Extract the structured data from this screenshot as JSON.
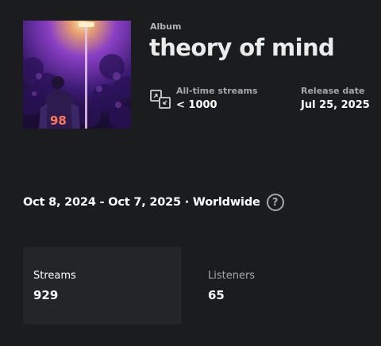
{
  "header": {
    "kind": "Album",
    "title": "theory of mind"
  },
  "cover": {
    "icon": "album-cover-art",
    "jersey_number": "98",
    "colors": [
      "#3a1a6e",
      "#8e3fc9",
      "#f7c36a",
      "#e45b9a"
    ]
  },
  "meta": {
    "streams_icon": "streams-swap-icon",
    "streams_label": "All-time streams",
    "streams_value": "< 1000",
    "release_label": "Release date",
    "release_value": "Jul 25, 2025"
  },
  "range": {
    "text": "Oct 8, 2024 - Oct 7, 2025 · Worldwide",
    "help_icon": "question-circle-icon",
    "help_glyph": "?"
  },
  "cards": [
    {
      "label": "Streams",
      "value": "929"
    },
    {
      "label": "Listeners",
      "value": "65"
    }
  ]
}
